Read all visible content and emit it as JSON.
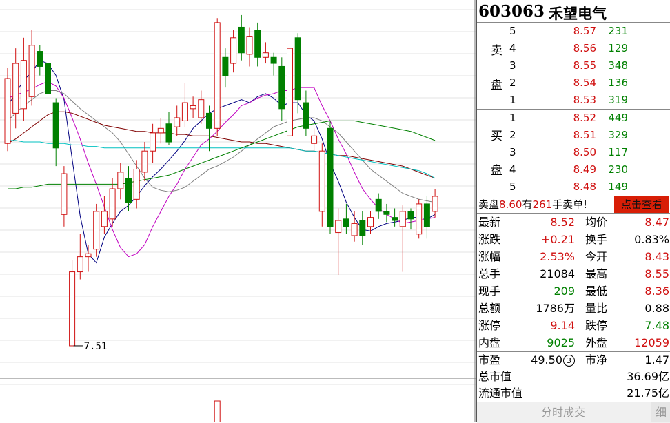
{
  "stock": {
    "code": "603063",
    "name": "禾望电气"
  },
  "orderbook": {
    "sell_label": [
      "卖",
      "盘"
    ],
    "buy_label": [
      "买",
      "盘"
    ],
    "sell": [
      {
        "level": "5",
        "price": "8.57",
        "volume": "231"
      },
      {
        "level": "4",
        "price": "8.56",
        "volume": "129"
      },
      {
        "level": "3",
        "price": "8.55",
        "volume": "348"
      },
      {
        "level": "2",
        "price": "8.54",
        "volume": "136"
      },
      {
        "level": "1",
        "price": "8.53",
        "volume": "319"
      }
    ],
    "buy": [
      {
        "level": "1",
        "price": "8.52",
        "volume": "449"
      },
      {
        "level": "2",
        "price": "8.51",
        "volume": "329"
      },
      {
        "level": "3",
        "price": "8.50",
        "volume": "117"
      },
      {
        "level": "4",
        "price": "8.49",
        "volume": "230"
      },
      {
        "level": "5",
        "price": "8.48",
        "volume": "149"
      }
    ]
  },
  "banner": {
    "prefix": "卖盘",
    "price": "8.60",
    "mid": "有",
    "qty": "261",
    "suffix": "手卖单!",
    "button": "点击查看"
  },
  "stats": [
    {
      "l1": "最新",
      "v1": "8.52",
      "c1": "red",
      "l2": "均价",
      "v2": "8.47",
      "c2": "red"
    },
    {
      "l1": "涨跌",
      "v1": "+0.21",
      "c1": "red",
      "l2": "换手",
      "v2": "0.83%",
      "c2": "blk"
    },
    {
      "l1": "涨幅",
      "v1": "2.53%",
      "c1": "red",
      "l2": "今开",
      "v2": "8.43",
      "c2": "red"
    },
    {
      "l1": "总手",
      "v1": "21084",
      "c1": "blk",
      "l2": "最高",
      "v2": "8.55",
      "c2": "red"
    },
    {
      "l1": "现手",
      "v1": "209",
      "c1": "green",
      "l2": "最低",
      "v2": "8.36",
      "c2": "red"
    },
    {
      "l1": "总额",
      "v1": "1786万",
      "c1": "blk",
      "l2": "量比",
      "v2": "0.88",
      "c2": "blk"
    },
    {
      "l1": "涨停",
      "v1": "9.14",
      "c1": "red",
      "l2": "跌停",
      "v2": "7.48",
      "c2": "green"
    },
    {
      "l1": "内盘",
      "v1": "9025",
      "c1": "green",
      "l2": "外盘",
      "v2": "12059",
      "c2": "red"
    }
  ],
  "valuation": {
    "pe_label": "市盈",
    "pe_value": "49.50",
    "pe_mark": "3",
    "pb_label": "市净",
    "pb_value": "1.47",
    "total_cap_label": "总市值",
    "total_cap_value": "36.69亿",
    "float_cap_label": "流通市值",
    "float_cap_value": "21.75亿"
  },
  "tabs": {
    "main": "分时成交",
    "detail": "细"
  },
  "chart_data": {
    "type": "candlestick",
    "low_annotation": "7.51",
    "ylim": [
      7.3,
      9.8
    ],
    "up_color": "#d01010",
    "down_color": "#008000",
    "candles": [
      {
        "o": 8.85,
        "c": 9.28,
        "h": 9.35,
        "l": 8.8
      },
      {
        "o": 9.05,
        "c": 9.38,
        "h": 9.48,
        "l": 8.95
      },
      {
        "o": 9.08,
        "c": 9.4,
        "h": 9.55,
        "l": 9.0
      },
      {
        "o": 9.16,
        "c": 9.5,
        "h": 9.6,
        "l": 9.1
      },
      {
        "o": 9.46,
        "c": 9.36,
        "h": 9.5,
        "l": 9.3
      },
      {
        "o": 9.38,
        "c": 9.18,
        "h": 9.42,
        "l": 9.08
      },
      {
        "o": 9.12,
        "c": 8.82,
        "h": 9.15,
        "l": 8.7
      },
      {
        "o": 8.38,
        "c": 8.65,
        "h": 8.7,
        "l": 8.3
      },
      {
        "o": 7.51,
        "c": 8.0,
        "h": 8.08,
        "l": 7.51
      },
      {
        "o": 8.0,
        "c": 8.1,
        "h": 8.25,
        "l": 7.95
      },
      {
        "o": 8.1,
        "c": 8.12,
        "h": 8.18,
        "l": 8.0
      },
      {
        "o": 8.15,
        "c": 8.4,
        "h": 8.45,
        "l": 8.1
      },
      {
        "o": 8.3,
        "c": 8.4,
        "h": 8.5,
        "l": 8.25
      },
      {
        "o": 8.35,
        "c": 8.55,
        "h": 8.62,
        "l": 8.3
      },
      {
        "o": 8.55,
        "c": 8.66,
        "h": 8.72,
        "l": 8.48
      },
      {
        "o": 8.62,
        "c": 8.46,
        "h": 8.7,
        "l": 8.4
      },
      {
        "o": 8.48,
        "c": 8.68,
        "h": 8.74,
        "l": 8.42
      },
      {
        "o": 8.66,
        "c": 8.8,
        "h": 8.86,
        "l": 8.6
      },
      {
        "o": 8.8,
        "c": 8.92,
        "h": 8.98,
        "l": 8.72
      },
      {
        "o": 8.92,
        "c": 8.95,
        "h": 9.02,
        "l": 8.85
      },
      {
        "o": 8.98,
        "c": 8.86,
        "h": 9.06,
        "l": 8.84
      },
      {
        "o": 8.96,
        "c": 9.02,
        "h": 9.1,
        "l": 8.9
      },
      {
        "o": 9.0,
        "c": 9.12,
        "h": 9.25,
        "l": 8.96
      },
      {
        "o": 9.08,
        "c": 9.1,
        "h": 9.16,
        "l": 9.02
      },
      {
        "o": 9.02,
        "c": 9.14,
        "h": 9.2,
        "l": 8.98
      },
      {
        "o": 9.05,
        "c": 8.95,
        "h": 9.1,
        "l": 8.8
      },
      {
        "o": 8.95,
        "c": 9.65,
        "h": 9.68,
        "l": 8.9
      },
      {
        "o": 9.42,
        "c": 9.3,
        "h": 9.48,
        "l": 9.22
      },
      {
        "o": 9.38,
        "c": 9.55,
        "h": 9.6,
        "l": 9.32
      },
      {
        "o": 9.62,
        "c": 9.45,
        "h": 9.7,
        "l": 9.4
      },
      {
        "o": 9.44,
        "c": 9.56,
        "h": 9.62,
        "l": 9.36
      },
      {
        "o": 9.6,
        "c": 9.42,
        "h": 9.65,
        "l": 9.36
      },
      {
        "o": 9.42,
        "c": 9.45,
        "h": 9.52,
        "l": 9.38
      },
      {
        "o": 9.42,
        "c": 9.38,
        "h": 9.45,
        "l": 9.3
      },
      {
        "o": 9.36,
        "c": 9.08,
        "h": 9.42,
        "l": 9.0
      },
      {
        "o": 8.9,
        "c": 9.48,
        "h": 9.5,
        "l": 8.85
      },
      {
        "o": 9.55,
        "c": 9.14,
        "h": 9.58,
        "l": 9.05
      },
      {
        "o": 9.12,
        "c": 8.95,
        "h": 9.2,
        "l": 8.9
      },
      {
        "o": 8.85,
        "c": 8.9,
        "h": 8.95,
        "l": 8.8
      },
      {
        "o": 8.4,
        "c": 8.8,
        "h": 8.85,
        "l": 8.3
      },
      {
        "o": 8.95,
        "c": 8.3,
        "h": 9.0,
        "l": 8.25
      },
      {
        "o": 8.26,
        "c": 8.34,
        "h": 8.42,
        "l": 7.98
      },
      {
        "o": 8.35,
        "c": 8.3,
        "h": 8.45,
        "l": 8.25
      },
      {
        "o": 8.24,
        "c": 8.32,
        "h": 8.4,
        "l": 8.2
      },
      {
        "o": 8.34,
        "c": 8.24,
        "h": 8.4,
        "l": 8.18
      },
      {
        "o": 8.3,
        "c": 8.36,
        "h": 8.4,
        "l": 8.25
      },
      {
        "o": 8.48,
        "c": 8.4,
        "h": 8.52,
        "l": 8.35
      },
      {
        "o": 8.4,
        "c": 8.38,
        "h": 8.45,
        "l": 8.33
      },
      {
        "o": 8.36,
        "c": 8.34,
        "h": 8.42,
        "l": 8.3
      },
      {
        "o": 8.3,
        "c": 8.4,
        "h": 8.44,
        "l": 8.0
      },
      {
        "o": 8.4,
        "c": 8.35,
        "h": 8.42,
        "l": 8.28
      },
      {
        "o": 8.25,
        "c": 8.45,
        "h": 8.48,
        "l": 8.22
      },
      {
        "o": 8.45,
        "c": 8.3,
        "h": 8.5,
        "l": 8.22
      },
      {
        "o": 8.4,
        "c": 8.5,
        "h": 8.55,
        "l": 8.36
      }
    ],
    "moving_averages": [
      {
        "color": "#000080",
        "values": [
          9.1,
          9.18,
          9.27,
          9.32,
          9.4,
          9.38,
          9.3,
          9.14,
          8.75,
          8.37,
          8.12,
          8.06,
          8.23,
          8.32,
          8.4,
          8.44,
          8.5,
          8.57,
          8.63,
          8.68,
          8.74,
          8.8,
          8.87,
          8.95,
          9.0,
          9.05,
          9.08,
          9.1,
          9.12,
          9.14,
          9.12,
          9.16,
          9.18,
          9.15,
          9.1,
          9.12,
          9.12,
          9.04,
          9.0,
          8.88,
          8.72,
          8.6,
          8.46,
          8.36,
          8.28,
          8.27,
          8.3,
          8.32,
          8.33,
          8.34,
          8.36,
          8.36,
          8.35,
          8.38
        ]
      },
      {
        "color": "#c000c0",
        "values": [
          9.15,
          9.17,
          9.19,
          9.21,
          9.24,
          9.26,
          9.23,
          9.15,
          9.02,
          8.88,
          8.72,
          8.58,
          8.43,
          8.28,
          8.16,
          8.1,
          8.12,
          8.18,
          8.3,
          8.4,
          8.5,
          8.58,
          8.68,
          8.76,
          8.84,
          8.88,
          8.93,
          8.99,
          9.04,
          9.1,
          9.12,
          9.15,
          9.17,
          9.18,
          9.2,
          9.2,
          9.22,
          9.22,
          9.22,
          9.1,
          9.0,
          8.88,
          8.78,
          8.66,
          8.55,
          8.48,
          8.42,
          8.38,
          8.35,
          8.32,
          8.33,
          8.34,
          8.35,
          8.36
        ]
      },
      {
        "color": "#808080",
        "values": [
          9.0,
          9.05,
          9.1,
          9.14,
          9.18,
          9.2,
          9.2,
          9.18,
          9.13,
          9.08,
          9.04,
          9.0,
          8.96,
          8.92,
          8.86,
          8.78,
          8.7,
          8.62,
          8.56,
          8.54,
          8.53,
          8.54,
          8.56,
          8.6,
          8.64,
          8.68,
          8.7,
          8.73,
          8.76,
          8.8,
          8.84,
          8.88,
          8.92,
          8.96,
          8.98,
          9.0,
          9.01,
          9.02,
          9.02,
          9.0,
          8.96,
          8.92,
          8.86,
          8.8,
          8.74,
          8.68,
          8.64,
          8.6,
          8.56,
          8.52,
          8.5,
          8.48,
          8.47,
          8.46
        ]
      },
      {
        "color": "#800000",
        "values": [
          8.85,
          8.88,
          8.92,
          8.96,
          9.0,
          9.04,
          9.06,
          9.06,
          9.05,
          9.03,
          9.01,
          8.99,
          8.97,
          8.96,
          8.95,
          8.94,
          8.93,
          8.93,
          8.92,
          8.92,
          8.92,
          8.91,
          8.91,
          8.9,
          8.9,
          8.9,
          8.89,
          8.88,
          8.87,
          8.86,
          8.86,
          8.85,
          8.85,
          8.84,
          8.83,
          8.82,
          8.81,
          8.8,
          8.8,
          8.79,
          8.78,
          8.77,
          8.77,
          8.76,
          8.75,
          8.74,
          8.73,
          8.72,
          8.71,
          8.7,
          8.68,
          8.66,
          8.64,
          8.62
        ]
      },
      {
        "color": "#00c0c0",
        "values": [
          8.87,
          8.87,
          8.86,
          8.86,
          8.86,
          8.85,
          8.85,
          8.85,
          8.84,
          8.84,
          8.83,
          8.83,
          8.82,
          8.82,
          8.82,
          8.82,
          8.82,
          8.82,
          8.82,
          8.82,
          8.82,
          8.82,
          8.82,
          8.82,
          8.82,
          8.82,
          8.82,
          8.82,
          8.82,
          8.82,
          8.82,
          8.82,
          8.82,
          8.82,
          8.82,
          8.82,
          8.81,
          8.8,
          8.8,
          8.79,
          8.78,
          8.77,
          8.76,
          8.75,
          8.74,
          8.73,
          8.72,
          8.71,
          8.7,
          8.69,
          8.68,
          8.67,
          8.65,
          8.62
        ]
      },
      {
        "color": "#008000",
        "values": [
          8.55,
          8.55,
          8.56,
          8.56,
          8.57,
          8.58,
          8.58,
          8.58,
          8.58,
          8.58,
          8.58,
          8.58,
          8.58,
          8.58,
          8.58,
          8.59,
          8.6,
          8.61,
          8.62,
          8.63,
          8.64,
          8.66,
          8.68,
          8.7,
          8.72,
          8.74,
          8.76,
          8.78,
          8.8,
          8.82,
          8.84,
          8.86,
          8.88,
          8.9,
          8.92,
          8.94,
          8.96,
          8.97,
          8.98,
          8.99,
          9.0,
          9.0,
          9.0,
          9.0,
          8.99,
          8.98,
          8.97,
          8.96,
          8.95,
          8.94,
          8.93,
          8.91,
          8.89,
          8.87
        ]
      }
    ],
    "volume_bars": [
      {
        "i": 26,
        "v": 1.0
      }
    ]
  }
}
